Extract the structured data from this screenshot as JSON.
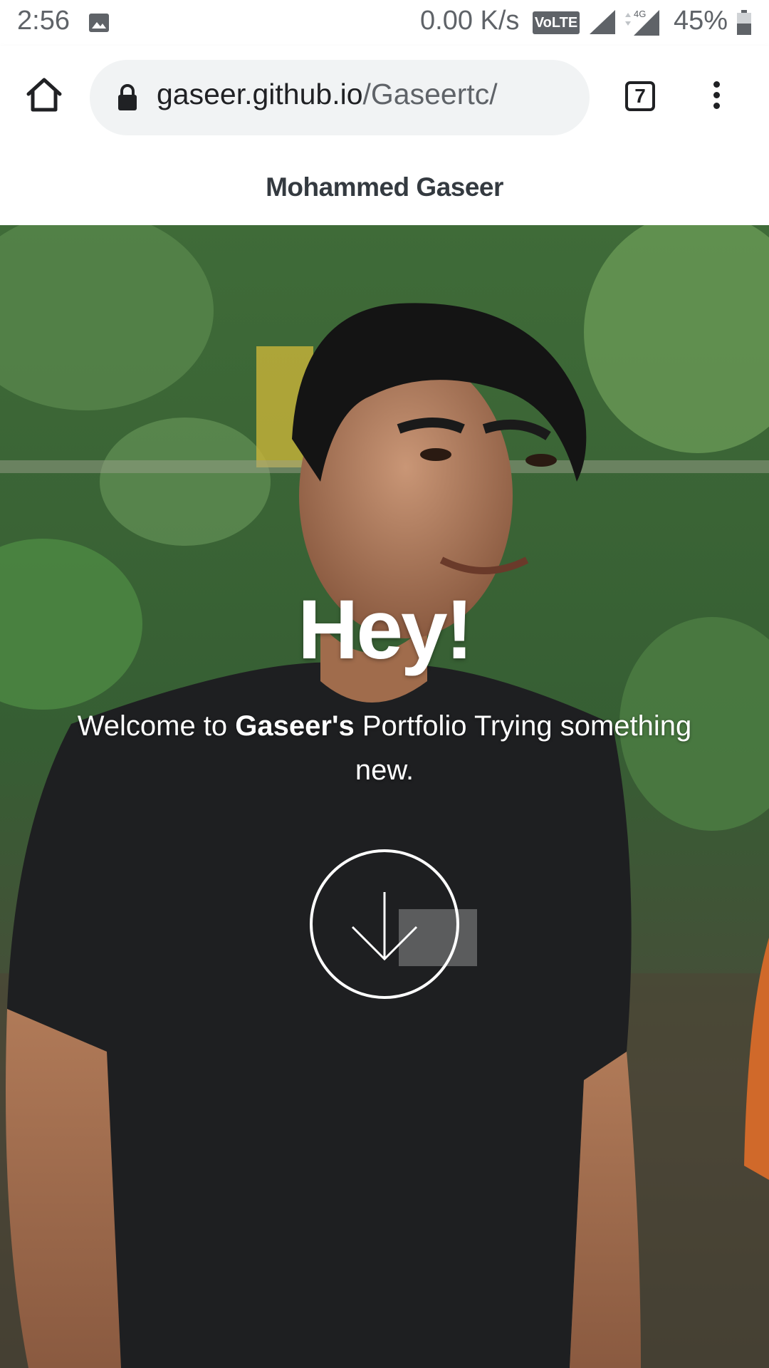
{
  "status_bar": {
    "time": "2:56",
    "network_speed": "0.00 K/s",
    "volte": "VoLTE",
    "network_type": "4G",
    "battery": "45%"
  },
  "browser": {
    "url_host": "gaseer.github.io",
    "url_path": "/Gaseertc/",
    "tab_count": "7"
  },
  "site": {
    "title": "Mohammed Gaseer"
  },
  "hero": {
    "heading": "Hey!",
    "subtitle_prefix": "Welcome to ",
    "subtitle_name": "Gaseer's",
    "subtitle_suffix": " Portfolio Trying something new."
  },
  "icons": {
    "status": [
      "image-icon",
      "signal-icon",
      "battery-icon"
    ],
    "browser": [
      "home-icon",
      "lock-icon",
      "tabs-icon",
      "menu-icon"
    ],
    "hero": [
      "arrow-down-icon"
    ]
  },
  "colors": {
    "header_text": "#343a40",
    "hero_text": "#ffffff",
    "url_pill": "#f1f3f4"
  }
}
